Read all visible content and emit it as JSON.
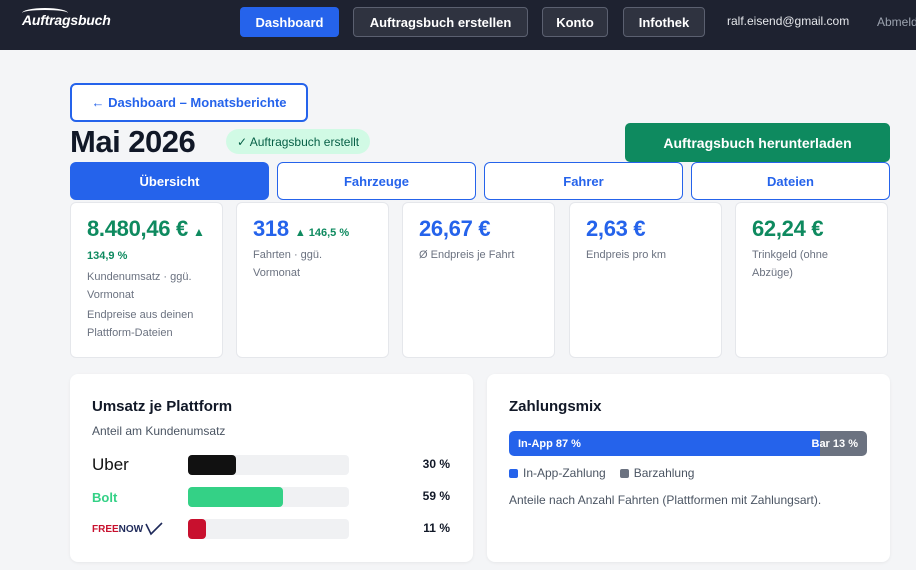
{
  "app": {
    "logo": "Auftragsbuch"
  },
  "nav": {
    "dashboard": "Dashboard",
    "create": "Auftragsbuch erstellen",
    "account": "Konto",
    "library": "Infothek",
    "email": "ralf.eisend@gmail.com",
    "logout": "Abmelden"
  },
  "back_label": "← Dashboard – Monatsberichte",
  "header": {
    "title": "Mai 2026",
    "status": "✓ Auftragsbuch erstellt",
    "download": "Auftragsbuch herunterladen"
  },
  "tabs": [
    {
      "label": "Übersicht",
      "active": true
    },
    {
      "label": "Fahrzeuge",
      "active": false
    },
    {
      "label": "Fahrer",
      "active": false
    },
    {
      "label": "Dateien",
      "active": false
    }
  ],
  "kpis": [
    {
      "value": "8.480,46 €",
      "delta": "▲ 134,9 %",
      "label": "Kundenumsatz · ggü. Vormonat",
      "note": "Endpreise aus deinen Plattform-Dateien"
    },
    {
      "value": "318",
      "delta": "▲ 146,5 %",
      "label": "Fahrten · ggü. Vormonat"
    },
    {
      "value": "26,67 €",
      "label": "Ø Endpreis je Fahrt"
    },
    {
      "value": "2,63 €",
      "label": "Endpreis pro km"
    },
    {
      "value": "62,24 €",
      "label": "Trinkgeld (ohne Abzüge)"
    }
  ],
  "platform_panel": {
    "title": "Umsatz je Plattform",
    "subtitle": "Anteil am Kundenumsatz",
    "rows": [
      {
        "logo": "Uber",
        "percent_text": "30 %",
        "share": 30,
        "color": "#111111"
      },
      {
        "logo": "Bolt",
        "percent_text": "59 %",
        "share": 59,
        "color": "#34d186"
      },
      {
        "logo_a": "FREE",
        "logo_b": "NOW",
        "percent_text": "11 %",
        "share": 11,
        "color": "#c8102e"
      }
    ]
  },
  "payment_panel": {
    "title": "Zahlungsmix",
    "in_app_label": "In-App 87 %",
    "in_app_share": 87,
    "cash_label": "Bar 13 %",
    "cash_share": 13,
    "legend_in_app": "In-App-Zahlung",
    "legend_cash": "Barzahlung",
    "note": "Anteile nach Anzahl Fahrten (Plattformen mit Zahlungsart).",
    "colors": {
      "in_app": "#2563eb",
      "cash": "#6b7280"
    }
  }
}
